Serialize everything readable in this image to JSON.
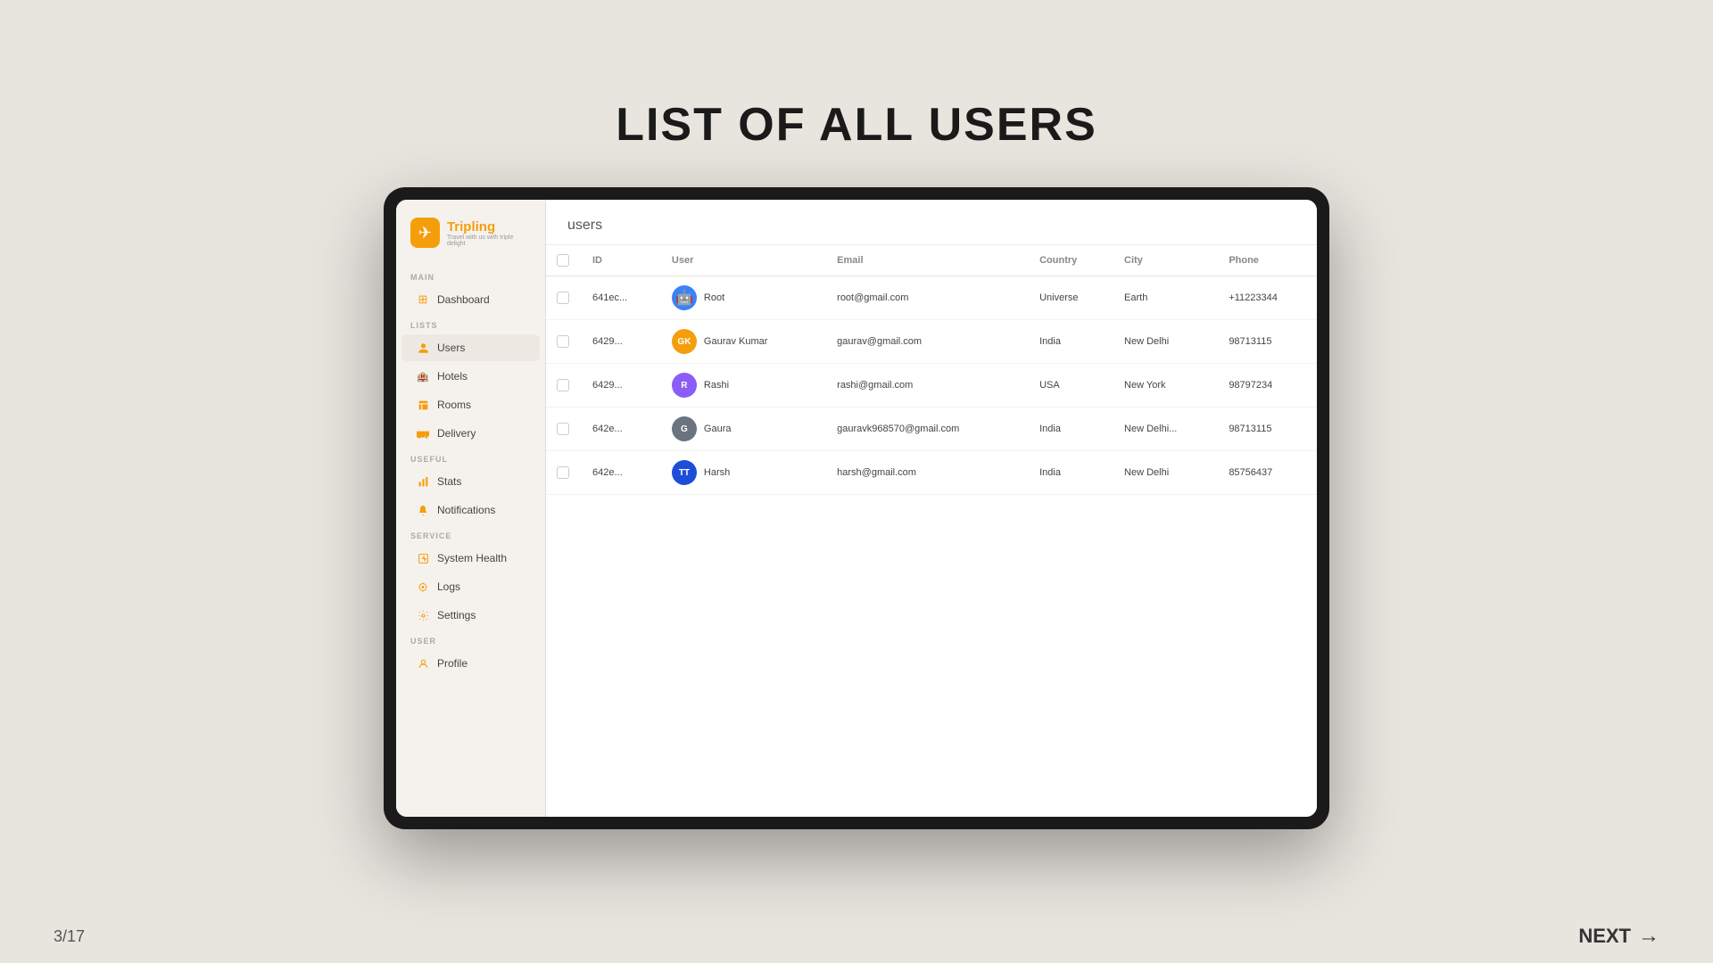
{
  "page": {
    "title": "LIST OF ALL USERS",
    "bg_color": "#e8e4de"
  },
  "pagination": {
    "current": "3/17",
    "next_label": "NEXT"
  },
  "sidebar": {
    "logo": {
      "name": "Tripling",
      "tagline": "Travel with us with triple delight"
    },
    "sections": [
      {
        "label": "MAIN",
        "items": [
          {
            "id": "dashboard",
            "label": "Dashboard",
            "icon": "⊞"
          }
        ]
      },
      {
        "label": "LISTS",
        "items": [
          {
            "id": "users",
            "label": "Users",
            "icon": "👤",
            "active": true
          },
          {
            "id": "hotels",
            "label": "Hotels",
            "icon": "🏨"
          },
          {
            "id": "rooms",
            "label": "Rooms",
            "icon": "🚪"
          },
          {
            "id": "delivery",
            "label": "Delivery",
            "icon": "📦"
          }
        ]
      },
      {
        "label": "USEFUL",
        "items": [
          {
            "id": "stats",
            "label": "Stats",
            "icon": "📊"
          },
          {
            "id": "notifications",
            "label": "Notifications",
            "icon": "🔔"
          }
        ]
      },
      {
        "label": "SERVICE",
        "items": [
          {
            "id": "system-health",
            "label": "System Health",
            "icon": "⚙️"
          },
          {
            "id": "logs",
            "label": "Logs",
            "icon": "📍"
          },
          {
            "id": "settings",
            "label": "Settings",
            "icon": "⚙️"
          }
        ]
      },
      {
        "label": "USER",
        "items": [
          {
            "id": "profile",
            "label": "Profile",
            "icon": "👤"
          }
        ]
      }
    ]
  },
  "table": {
    "title": "users",
    "columns": [
      "ID",
      "User",
      "Email",
      "Country",
      "City",
      "Phone"
    ],
    "rows": [
      {
        "id": "641ec...",
        "user": "Root",
        "avatar_type": "robot",
        "avatar_text": "🤖",
        "email": "root@gmail.com",
        "country": "Universe",
        "city": "Earth",
        "phone": "+11223344"
      },
      {
        "id": "6429...",
        "user": "Gaurav Kumar",
        "avatar_type": "gaurav",
        "avatar_text": "GK",
        "email": "gaurav@gmail.com",
        "country": "India",
        "city": "New Delhi",
        "phone": "98713115"
      },
      {
        "id": "6429...",
        "user": "Rashi",
        "avatar_type": "rashi",
        "avatar_text": "R",
        "email": "rashi@gmail.com",
        "country": "USA",
        "city": "New York",
        "phone": "98797234"
      },
      {
        "id": "642e...",
        "user": "Gaura",
        "avatar_type": "gaura",
        "avatar_text": "G",
        "email": "gauravk968570@gmail.com",
        "country": "India",
        "city": "New Delhi...",
        "phone": "98713115"
      },
      {
        "id": "642e...",
        "user": "Harsh",
        "avatar_type": "harsh",
        "avatar_text": "TT",
        "email": "harsh@gmail.com",
        "country": "India",
        "city": "New Delhi",
        "phone": "85756437"
      }
    ]
  }
}
